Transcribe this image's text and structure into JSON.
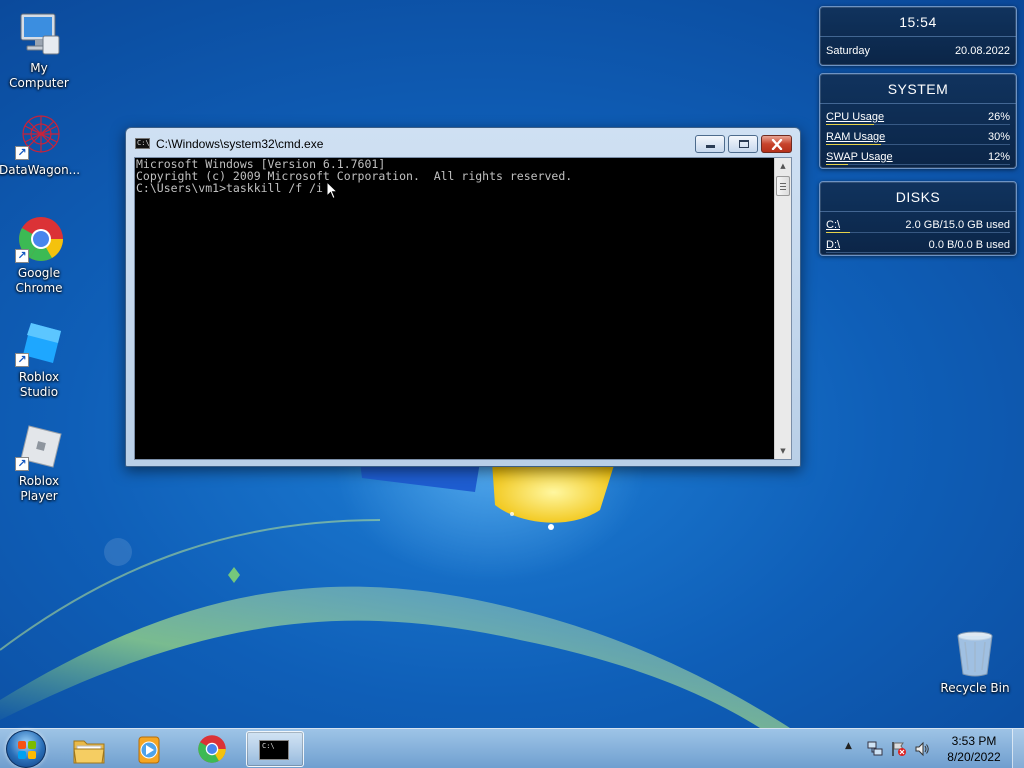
{
  "desktop_icons": [
    {
      "label": "My Computer",
      "icon": "computer-icon"
    },
    {
      "label": "DataWagon...",
      "icon": "datawagon-icon"
    },
    {
      "label": "Google Chrome",
      "icon": "chrome-icon"
    },
    {
      "label": "Roblox Studio",
      "icon": "roblox-studio-icon"
    },
    {
      "label": "Roblox Player",
      "icon": "roblox-player-icon"
    },
    {
      "label": "Recycle Bin",
      "icon": "recycle-bin-icon"
    }
  ],
  "clock_gadget": {
    "time": "15:54",
    "day": "Saturday",
    "date": "20.08.2022"
  },
  "system_gadget": {
    "title": "SYSTEM",
    "rows": [
      {
        "label": "CPU Usage",
        "value": "26%",
        "fraction": 0.26
      },
      {
        "label": "RAM Usage",
        "value": "30%",
        "fraction": 0.3
      },
      {
        "label": "SWAP Usage",
        "value": "12%",
        "fraction": 0.12
      }
    ]
  },
  "disks_gadget": {
    "title": "DISKS",
    "rows": [
      {
        "label": "C:\\",
        "value": "2.0 GB/15.0 GB used",
        "fraction": 0.133
      },
      {
        "label": "D:\\",
        "value": "0.0 B/0.0 B used",
        "fraction": 0.0
      }
    ]
  },
  "cmd_window": {
    "title": "C:\\Windows\\system32\\cmd.exe",
    "icon_text": "C:\\",
    "lines": [
      "Microsoft Windows [Version 6.1.7601]",
      "Copyright (c) 2009 Microsoft Corporation.  All rights reserved.",
      "",
      "C:\\Users\\vm1>taskkill /f /i"
    ]
  },
  "taskbar": {
    "pinned": [
      "explorer-icon",
      "media-player-icon",
      "chrome-icon",
      "cmd-icon"
    ],
    "active": "cmd-icon",
    "clock_time": "3:53 PM",
    "clock_date": "8/20/2022"
  },
  "colors": {
    "console_text": "#c0c0c0",
    "console_bg": "#000000",
    "gadget_bg": "#10335e",
    "usage_bar": "#e6d24a"
  }
}
